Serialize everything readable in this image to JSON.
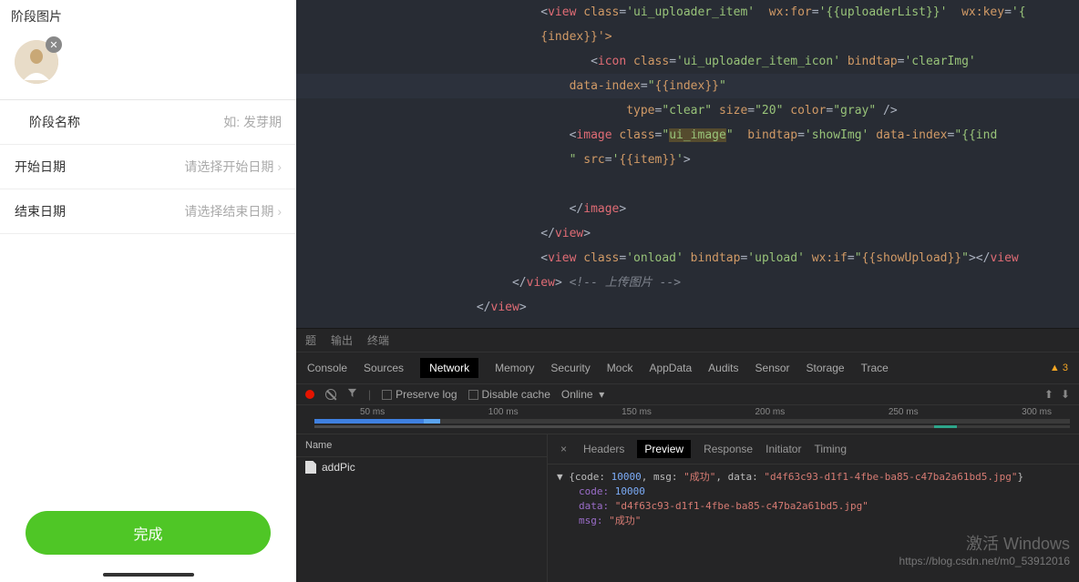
{
  "mobile": {
    "section_title": "阶段图片",
    "rows": {
      "name_label": "阶段名称",
      "name_placeholder": "如: 发芽期",
      "start_label": "开始日期",
      "start_placeholder": "请选择开始日期",
      "end_label": "结束日期",
      "end_placeholder": "请选择结束日期"
    },
    "submit": "完成"
  },
  "code": {
    "l1_a": "<view",
    "l1_b": "class",
    "l1_c": "'ui_uploader_item'",
    "l1_d": "wx:for",
    "l1_e": "'{{uploaderList}}'",
    "l1_f": "wx:key",
    "l1_g": "'{",
    "l2": "{index}}'>",
    "l3_a": "<icon",
    "l3_b": "class",
    "l3_c": "'ui_uploader_item_icon'",
    "l3_d": "bindtap",
    "l3_e": "'clearImg'",
    "l4_a": "data-index",
    "l4_b": "\"{{index}}\"",
    "l5_a": "type",
    "l5_b": "\"clear\"",
    "l5_c": "size",
    "l5_d": "\"20\"",
    "l5_e": "color",
    "l5_f": "\"gray\"",
    "l5_g": "/>",
    "l6_a": "<image",
    "l6_b": "class",
    "l6_c": "\"ui_image\"",
    "l6_d": "bindtap",
    "l6_e": "'showImg'",
    "l6_f": "data-index",
    "l6_g": "\"{{ind",
    "l7_a": "\" src=",
    "l7_b": "'{{item}}'",
    "l8": "</image>",
    "l9": "</view>",
    "l10_a": "<view",
    "l10_b": "class",
    "l10_c": "'onload'",
    "l10_d": "bindtap",
    "l10_e": "'upload'",
    "l10_f": "wx:if",
    "l10_g": "\"{{showUpload}}\"",
    "l10_h": "></view",
    "l11_a": "</view>",
    "l11_b": "<!-- 上传图片 -->",
    "l12": "</view>"
  },
  "devtools": {
    "topbar": {
      "a": "题",
      "b": "输出",
      "c": "终端"
    },
    "tabs": [
      "Console",
      "Sources",
      "Network",
      "Memory",
      "Security",
      "Mock",
      "AppData",
      "Audits",
      "Sensor",
      "Storage",
      "Trace"
    ],
    "active_tab": "Network",
    "warn_count": "3",
    "toolbar": {
      "preserve": "Preserve log",
      "disable": "Disable cache",
      "online": "Online"
    },
    "timeline_labels": [
      "50 ms",
      "100 ms",
      "150 ms",
      "200 ms",
      "250 ms",
      "300 ms"
    ],
    "req_header": "Name",
    "req_name": "addPic",
    "resp_tabs": [
      "Headers",
      "Preview",
      "Response",
      "Initiator",
      "Timing"
    ],
    "resp_active": "Preview",
    "json": {
      "summary_prefix": "▼ {code: ",
      "code_v": "10000",
      "msg_k": ", msg: ",
      "msg_v": "\"成功\"",
      "data_k": ", data: ",
      "data_v": "\"d4f63c93-d1f1-4fbe-ba85-c47ba2a61bd5.jpg\"",
      "summary_suffix": "}",
      "code_label": "code: ",
      "data_label": "data: ",
      "msg_label": "msg: "
    }
  },
  "watermark": {
    "title": "激活 Windows",
    "url": "https://blog.csdn.net/m0_53912016"
  }
}
